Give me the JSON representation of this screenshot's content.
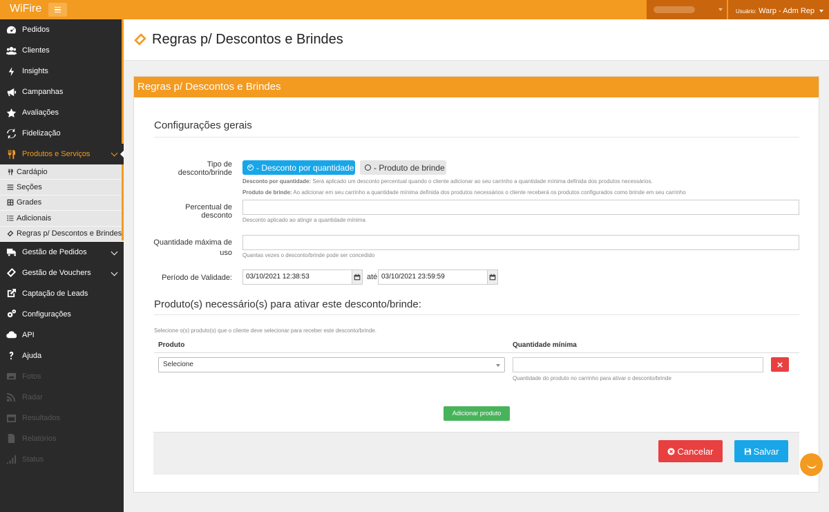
{
  "app": {
    "brand": "WiFire",
    "user_prefix": "Usuário:",
    "user_name": "Warp - Adm Rep"
  },
  "sidebar": {
    "items": [
      {
        "label": "Pedidos",
        "icon": "dashboard-icon"
      },
      {
        "label": "Clientes",
        "icon": "users-icon"
      },
      {
        "label": "Insights",
        "icon": "bolt-icon"
      },
      {
        "label": "Campanhas",
        "icon": "megaphone-icon"
      },
      {
        "label": "Avaliações",
        "icon": "star-icon"
      },
      {
        "label": "Fidelização",
        "icon": "refresh-icon"
      },
      {
        "label": "Produtos e Serviços",
        "icon": "cutlery-icon",
        "active": true
      }
    ],
    "subitems": [
      {
        "label": "Cardápio",
        "icon": "cutlery-icon"
      },
      {
        "label": "Seções",
        "icon": "list-icon"
      },
      {
        "label": "Grades",
        "icon": "grid-icon"
      },
      {
        "label": "Adicionais",
        "icon": "list-ol-icon"
      },
      {
        "label": "Regras p/ Descontos e Brindes",
        "icon": "ticket-icon"
      }
    ],
    "items2": [
      {
        "label": "Gestão de Pedidos",
        "icon": "truck-icon"
      },
      {
        "label": "Gestão de Vouchers",
        "icon": "ticket-icon"
      },
      {
        "label": "Captação de Leads",
        "icon": "external-link-icon"
      },
      {
        "label": "Configurações",
        "icon": "cogs-icon"
      },
      {
        "label": "API",
        "icon": "cloud-icon"
      },
      {
        "label": "Ajuda",
        "icon": "question-icon"
      },
      {
        "label": "Fotos",
        "icon": "image-icon"
      },
      {
        "label": "Radar",
        "icon": "rss-icon"
      },
      {
        "label": "Resultados",
        "icon": "calendar-icon"
      },
      {
        "label": "Relatórios",
        "icon": "file-icon"
      },
      {
        "label": "Status",
        "icon": "signal-icon"
      }
    ]
  },
  "page": {
    "title": "Regras p/ Descontos e Brindes",
    "panel_title": "Regras p/ Descontos e Brindes",
    "section_general": "Configurações gerais",
    "tipo_label": "Tipo de desconto/brinde",
    "tipo_option_qty": "- Desconto por quantidade",
    "tipo_option_gift": "- Produto de brinde",
    "help_qty_bold": "Desconto por quantidade:",
    "help_qty_text": " Será aplicado um desconto percentual quando o cliente adicionar ao seu carrinho a quantidade mínima definida dos produtos necessários.",
    "help_gift_bold": "Produto de brinde:",
    "help_gift_text": " Ao adicionar em seu carrinho a quantidade mínima definida dos produtos necessários o cliente receberá os produtos configurados como brinde em seu carrinho",
    "percentual_label": "Percentual de desconto",
    "percentual_value": "",
    "percentual_help": "Desconto aplicado ao atingir a quantidade mínima",
    "qtd_max_label": "Quantidade máxima de uso",
    "qtd_max_value": "",
    "qtd_max_help": "Quantas vezes o desconto/brinde pode ser concedido",
    "periodo_label": "Período de Validade:",
    "periodo_start": "03/10/2021 12:38:53",
    "periodo_sep": "até",
    "periodo_end": "03/10/2021 23:59:59",
    "section_products": "Produto(s) necessário(s) para ativar este desconto/brinde:",
    "products_help": "Selecione o(s) produto(s) que o cliente deve selecionar para receber este desconto/brinde.",
    "col_product": "Produto",
    "col_qty": "Quantidade mínima",
    "product_select": "Selecione",
    "qty_value": "",
    "qty_help": "Quantidade do produto no carrinho para ativar o desconto/brinde",
    "add_product": "Adicionar produto",
    "cancel": "Cancelar",
    "save": "Salvar"
  },
  "colors": {
    "accent": "#f39a20",
    "primary": "#19a6e8",
    "danger": "#e84040",
    "success": "#48b35a"
  }
}
